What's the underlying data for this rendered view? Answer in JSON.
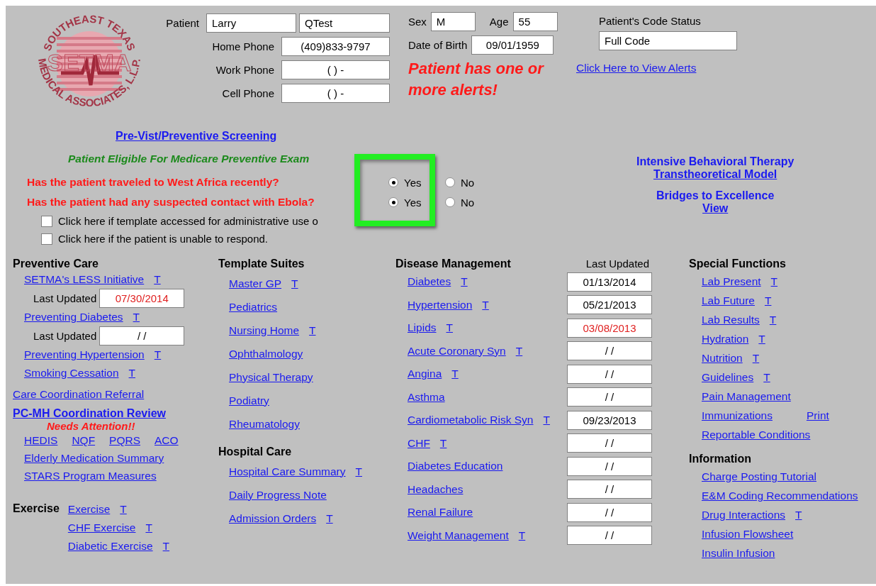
{
  "logo": {
    "top_text": "SOUTHEAST TEXAS",
    "bottom_text": "MEDICAL ASSOCIATES, L.L.P.",
    "center_text": "SETMA"
  },
  "patient": {
    "label": "Patient",
    "first_name": "Larry",
    "last_name": "QTest",
    "phones": [
      {
        "label": "Home Phone",
        "value": "(409)833-9797"
      },
      {
        "label": "Work Phone",
        "value": "(  )   -"
      },
      {
        "label": "Cell Phone",
        "value": "(  )   -"
      }
    ],
    "sex_label": "Sex",
    "sex": "M",
    "age_label": "Age",
    "age": "55",
    "dob_label": "Date of Birth",
    "dob": "09/01/1959",
    "alert": "Patient has one or more alerts!",
    "alert_link": "Click Here to View Alerts",
    "code_status_label": "Patient's Code Status",
    "code_status": "Full Code"
  },
  "screening_link": "Pre-Vist/Preventive Screening",
  "eligibility": "Patient Eligible For Medicare Preventive Exam",
  "questions": [
    {
      "text": "Has the patient traveled to West Africa recently?",
      "options": [
        {
          "label": "Yes",
          "selected": true
        },
        {
          "label": "No",
          "selected": false
        }
      ]
    },
    {
      "text": "Has the patient had any suspected contact with Ebola?",
      "options": [
        {
          "label": "Yes",
          "selected": true
        },
        {
          "label": "No",
          "selected": false
        }
      ]
    }
  ],
  "checkboxes": [
    {
      "label": "Click here if template accessed for administrative use o",
      "checked": false
    },
    {
      "label": "Click here if the patient is unable to respond.",
      "checked": false
    }
  ],
  "side_links": [
    {
      "title": "Intensive Behavioral Therapy",
      "link": "Transtheoretical Model"
    },
    {
      "title": "Bridges to Excellence",
      "link": "View"
    }
  ],
  "preventive_care": {
    "heading": "Preventive Care",
    "items": [
      {
        "kind": "link",
        "label": "SETMA's LESS Initiative",
        "t": "T"
      },
      {
        "kind": "updated",
        "label": "Last Updated",
        "value": "07/30/2014",
        "color": "#e02020"
      },
      {
        "kind": "link",
        "label": "Preventing Diabetes",
        "t": "T"
      },
      {
        "kind": "updated",
        "label": "Last Updated",
        "value": "/ /",
        "color": "#000000"
      },
      {
        "kind": "link",
        "label": "Preventing Hypertension",
        "t": "T"
      },
      {
        "kind": "link",
        "label": "Smoking Cessation",
        "t": "T"
      }
    ],
    "referral": "Care Coordination Referral",
    "review": "PC-MH Coordination Review",
    "attention": "Needs Attention!!",
    "measures": [
      "HEDIS",
      "NQF",
      "PQRS",
      "ACO"
    ],
    "more": [
      "Elderly Medication Summary",
      "STARS Program Measures"
    ]
  },
  "exercise": {
    "heading": "Exercise",
    "items": [
      {
        "label": "Exercise",
        "t": "T"
      },
      {
        "label": "CHF Exercise",
        "t": "T"
      },
      {
        "label": "Diabetic Exercise",
        "t": "T"
      }
    ]
  },
  "template_suites": {
    "heading": "Template Suites",
    "items": [
      {
        "label": "Master GP",
        "t": "T"
      },
      {
        "label": "Pediatrics"
      },
      {
        "label": "Nursing Home",
        "t": "T"
      },
      {
        "label": "Ophthalmology"
      },
      {
        "label": "Physical Therapy"
      },
      {
        "label": "Podiatry"
      },
      {
        "label": "Rheumatology"
      }
    ]
  },
  "hospital_care": {
    "heading": "Hospital Care",
    "items": [
      {
        "label": "Hospital Care Summary",
        "t": "T"
      },
      {
        "label": "Daily Progress Note"
      },
      {
        "label": "Admission Orders",
        "t": "T"
      }
    ]
  },
  "disease_management": {
    "heading": "Disease Management",
    "date_heading": "Last Updated",
    "rows": [
      {
        "label": "Diabetes",
        "t": "T",
        "date": "01/13/2014",
        "color": "#000000"
      },
      {
        "label": "Hypertension",
        "t": "T",
        "date": "05/21/2013",
        "color": "#000000"
      },
      {
        "label": "Lipids",
        "t": "T",
        "date": "03/08/2013",
        "color": "#e02020"
      },
      {
        "label": "Acute Coronary Syn",
        "t": "T",
        "date": "/ /",
        "color": "#000000"
      },
      {
        "label": "Angina",
        "t": "T",
        "date": "/ /",
        "color": "#000000"
      },
      {
        "label": "Asthma",
        "date": "/ /",
        "color": "#000000"
      },
      {
        "label": "Cardiometabolic Risk Syn",
        "t": "T",
        "date": "09/23/2013",
        "color": "#000000"
      },
      {
        "label": "CHF",
        "t": "T",
        "date": "/ /",
        "color": "#000000"
      },
      {
        "label": "Diabetes Education",
        "date": "/ /",
        "color": "#000000"
      },
      {
        "label": "Headaches",
        "date": "/ /",
        "color": "#000000"
      },
      {
        "label": "Renal Failure",
        "date": "/ /",
        "color": "#000000"
      },
      {
        "label": "Weight Management",
        "t": "T",
        "date": "/ /",
        "color": "#000000"
      }
    ]
  },
  "special_functions": {
    "heading": "Special Functions",
    "items": [
      {
        "label": "Lab Present",
        "t": "T"
      },
      {
        "label": "Lab Future",
        "t": "T"
      },
      {
        "label": "Lab Results",
        "t": "T"
      },
      {
        "label": "Hydration",
        "t": "T"
      },
      {
        "label": "Nutrition",
        "t": "T"
      },
      {
        "label": "Guidelines",
        "t": "T"
      },
      {
        "label": "Pain Management"
      },
      {
        "label": "Immunizations",
        "extra": "Print"
      },
      {
        "label": "Reportable Conditions"
      }
    ]
  },
  "information": {
    "heading": "Information",
    "items": [
      {
        "label": "Charge Posting Tutorial"
      },
      {
        "label": "E&M Coding Recommendations"
      },
      {
        "label": "Drug Interactions",
        "t": "T"
      },
      {
        "label": "Infusion Flowsheet"
      },
      {
        "label": "Insulin Infusion"
      }
    ]
  }
}
